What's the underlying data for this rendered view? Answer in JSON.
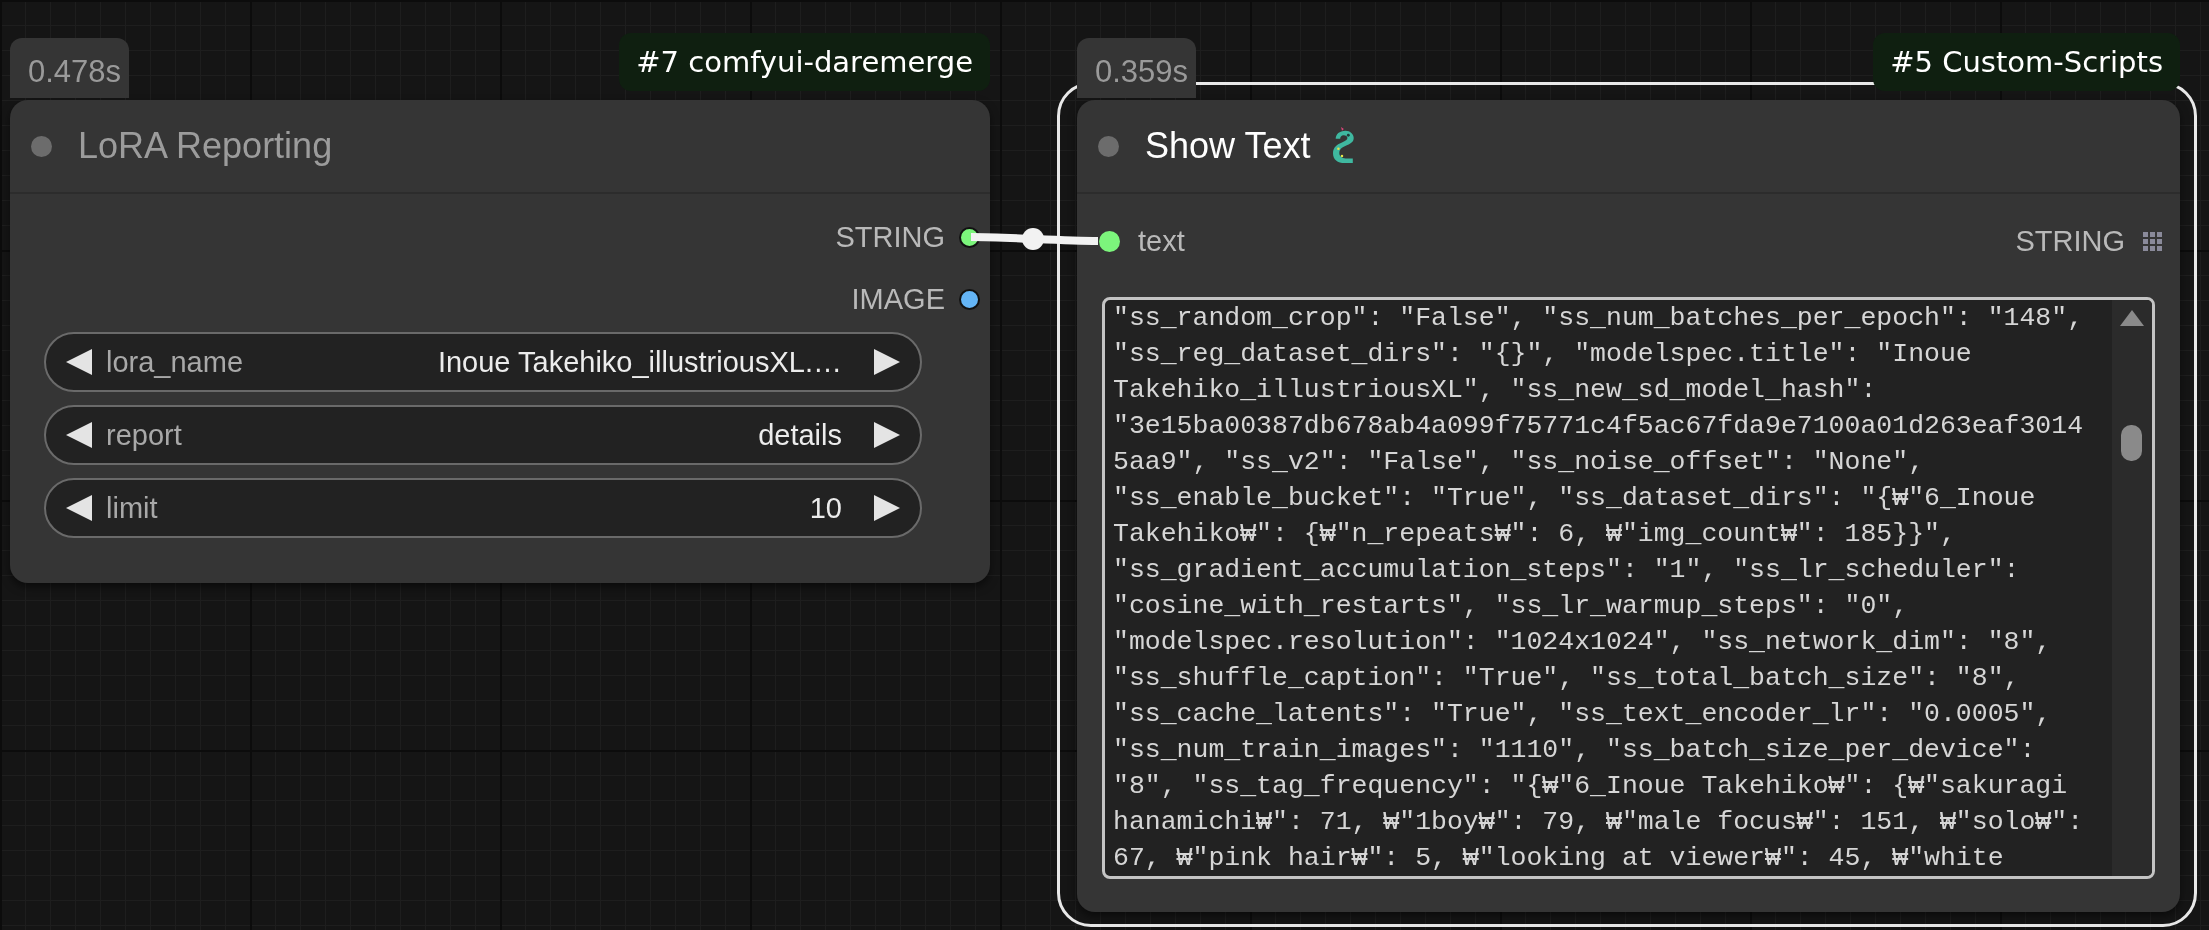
{
  "nodes": [
    {
      "time": "0.478s",
      "tag": "#7 comfyui-daremerge",
      "title": "LoRA Reporting",
      "selected": false,
      "outputs": [
        {
          "label": "STRING",
          "color": "#7cf57c"
        },
        {
          "label": "IMAGE",
          "color": "#64b5f6"
        }
      ],
      "widgets": [
        {
          "label": "lora_name",
          "value": "Inoue Takehiko_illustriousXL.…"
        },
        {
          "label": "report",
          "value": "details"
        },
        {
          "label": "limit",
          "value": "10"
        }
      ]
    },
    {
      "time": "0.359s",
      "tag": "#5 Custom-Scripts",
      "title": "Show Text",
      "selected": true,
      "inputs": [
        {
          "label": "text",
          "type": "STRING",
          "color": "#7cf57c"
        }
      ],
      "text_lines": [
        "\"ss_random_crop\": \"False\", \"ss_num_batches_per_epoch\": \"148\",",
        "\"ss_reg_dataset_dirs\": \"{}\", \"modelspec.title\": \"Inoue",
        "Takehiko_illustriousXL\", \"ss_new_sd_model_hash\":",
        "\"3e15ba00387db678ab4a099f75771c4f5ac67fda9e7100a01d263eaf3014",
        "5aa9\", \"ss_v2\": \"False\", \"ss_noise_offset\": \"None\",",
        "\"ss_enable_bucket\": \"True\", \"ss_dataset_dirs\": \"{₩\"6_Inoue",
        "Takehiko₩\": {₩\"n_repeats₩\": 6, ₩\"img_count₩\": 185}}\",",
        "\"ss_gradient_accumulation_steps\": \"1\", \"ss_lr_scheduler\":",
        "\"cosine_with_restarts\", \"ss_lr_warmup_steps\": \"0\",",
        "\"modelspec.resolution\": \"1024x1024\", \"ss_network_dim\": \"8\",",
        "\"ss_shuffle_caption\": \"True\", \"ss_total_batch_size\": \"8\",",
        "\"ss_cache_latents\": \"True\", \"ss_text_encoder_lr\": \"0.0005\",",
        "\"ss_num_train_images\": \"1110\", \"ss_batch_size_per_device\":",
        "\"8\", \"ss_tag_frequency\": \"{₩\"6_Inoue Takehiko₩\": {₩\"sakuragi",
        "hanamichi₩\": 71, ₩\"1boy₩\": 79, ₩\"male focus₩\": 151, ₩\"solo₩\":",
        "67, ₩\"pink hair₩\": 5, ₩\"looking at viewer₩\": 45, ₩\"white"
      ]
    }
  ]
}
